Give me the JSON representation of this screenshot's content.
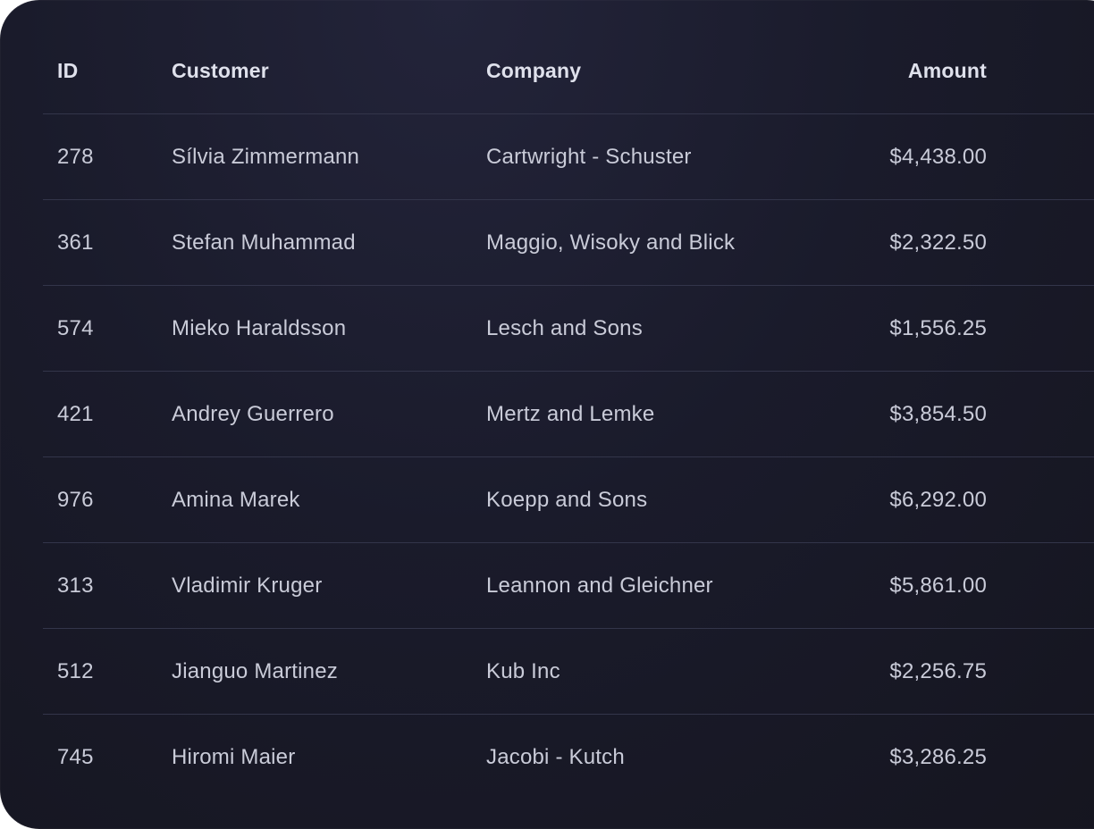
{
  "table": {
    "columns": {
      "id": "ID",
      "customer": "Customer",
      "company": "Company",
      "amount": "Amount"
    },
    "rows": [
      {
        "id": "278",
        "customer": "Sílvia Zimmermann",
        "company": "Cartwright - Schuster",
        "amount": "$4,438.00"
      },
      {
        "id": "361",
        "customer": "Stefan Muhammad",
        "company": "Maggio, Wisoky and Blick",
        "amount": "$2,322.50"
      },
      {
        "id": "574",
        "customer": "Mieko Haraldsson",
        "company": "Lesch and Sons",
        "amount": "$1,556.25"
      },
      {
        "id": "421",
        "customer": "Andrey Guerrero",
        "company": "Mertz and Lemke",
        "amount": "$3,854.50"
      },
      {
        "id": "976",
        "customer": "Amina Marek",
        "company": "Koepp and Sons",
        "amount": "$6,292.00"
      },
      {
        "id": "313",
        "customer": "Vladimir Kruger",
        "company": "Leannon and Gleichner",
        "amount": "$5,861.00"
      },
      {
        "id": "512",
        "customer": "Jianguo Martinez",
        "company": "Kub Inc",
        "amount": "$2,256.75"
      },
      {
        "id": "745",
        "customer": "Hiromi Maier",
        "company": "Jacobi - Kutch",
        "amount": "$3,286.25"
      }
    ]
  }
}
